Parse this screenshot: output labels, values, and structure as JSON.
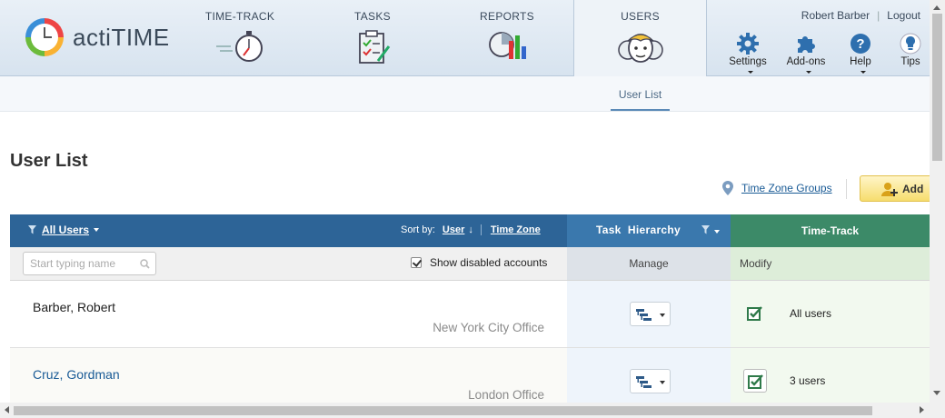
{
  "app": {
    "logo_text": "actiTIME"
  },
  "nav": {
    "timetrack": "TIME-TRACK",
    "tasks": "TASKS",
    "reports": "REPORTS",
    "users": "USERS"
  },
  "userbar": {
    "user": "Robert Barber",
    "separator": "|",
    "logout": "Logout"
  },
  "tools": {
    "settings": "Settings",
    "addons": "Add-ons",
    "help": "Help",
    "tips": "Tips"
  },
  "subnav": {
    "user_list_tab": "User List"
  },
  "page": {
    "title": "User List"
  },
  "actions": {
    "time_zone_groups": "Time Zone Groups",
    "add": "Add"
  },
  "table": {
    "filter_label": "All Users",
    "sort_by_label": "Sort by:",
    "sort_user": "User",
    "sort_arrow": "↓",
    "sort_timezone": "Time Zone",
    "task_hierarchy": "Task  Hierarchy",
    "time_track": "Time-Track",
    "search_placeholder": "Start typing name",
    "show_disabled": "Show disabled accounts",
    "manage": "Manage",
    "modify": "Modify",
    "rows": [
      {
        "name": "Barber, Robert",
        "office": "New York City Office",
        "timetrack": "All users"
      },
      {
        "name": "Cruz, Gordman",
        "office": "London Office",
        "timetrack": "3 users"
      }
    ]
  },
  "colors": {
    "users_header": "#2d6497",
    "task_header": "#3a78ad",
    "time_header": "#3c8a68",
    "link": "#1a5b96"
  }
}
